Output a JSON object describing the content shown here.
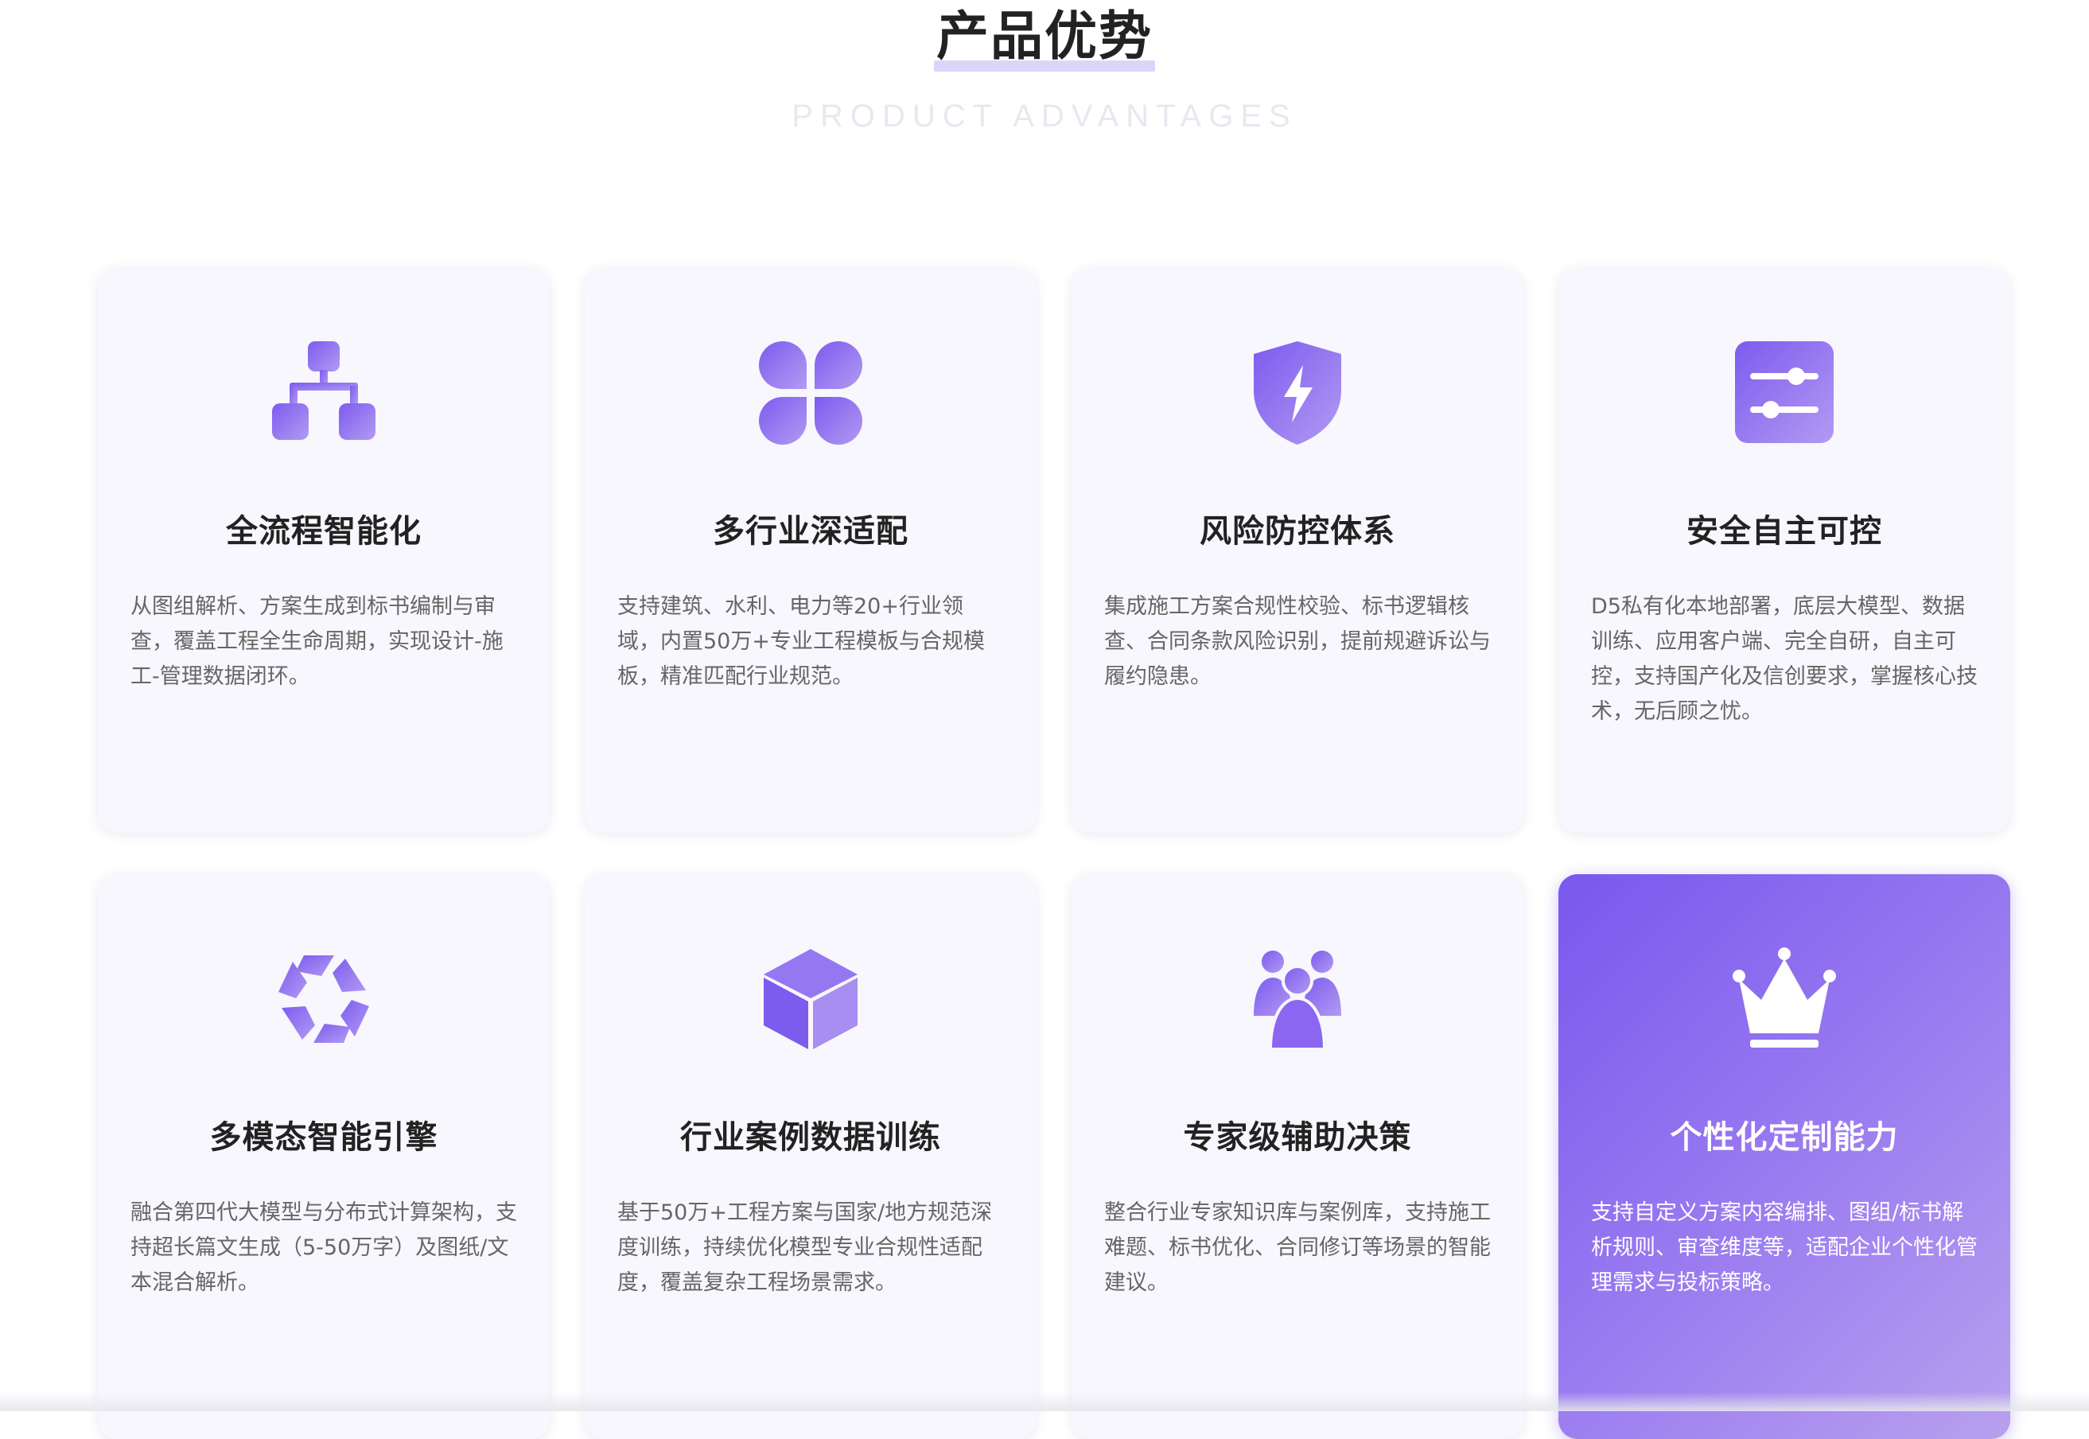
{
  "header": {
    "title": "产品优势",
    "subtitle": "PRODUCT ADVANTAGES"
  },
  "colors": {
    "accent": "#8b66f0",
    "accent_light": "#b39af2",
    "card_bg": "#f8f7fd",
    "title_underline": "#dcd4fa"
  },
  "cards": [
    {
      "icon": "hierarchy-icon",
      "title": "全流程智能化",
      "desc": "从图组解析、方案生成到标书编制与审查，覆盖工程全生命周期，实现设计-施工-管理数据闭环。",
      "active": false
    },
    {
      "icon": "four-leaf-grid-icon",
      "title": "多行业深适配",
      "desc": "支持建筑、水利、电力等20+行业领域，内置50万+专业工程模板与合规模板，精准匹配行业规范。",
      "active": false
    },
    {
      "icon": "shield-lightning-icon",
      "title": "风险防控体系",
      "desc": "集成施工方案合规性校验、标书逻辑核查、合同条款风险识别，提前规避诉讼与履约隐患。",
      "active": false
    },
    {
      "icon": "sliders-icon",
      "title": "安全自主可控",
      "desc": "D5私有化本地部署，底层大模型、数据训练、应用客户端、完全自研，自主可控，支持国产化及信创要求，掌握核心技术，无后顾之忧。",
      "active": false
    },
    {
      "icon": "aperture-icon",
      "title": "多模态智能引擎",
      "desc": "融合第四代大模型与分布式计算架构，支持超长篇文生成（5-50万字）及图纸/文本混合解析。",
      "active": false
    },
    {
      "icon": "cube-icon",
      "title": "行业案例数据训练",
      "desc": "基于50万+工程方案与国家/地方规范深度训练，持续优化模型专业合规性适配度，覆盖复杂工程场景需求。",
      "active": false
    },
    {
      "icon": "user-group-icon",
      "title": "专家级辅助决策",
      "desc": "整合行业专家知识库与案例库，支持施工难题、标书优化、合同修订等场景的智能建议。",
      "active": false
    },
    {
      "icon": "crown-icon",
      "title": "个性化定制能力",
      "desc": "支持自定义方案内容编排、图组/标书解析规则、审查维度等，适配企业个性化管理需求与投标策略。",
      "active": true
    }
  ]
}
